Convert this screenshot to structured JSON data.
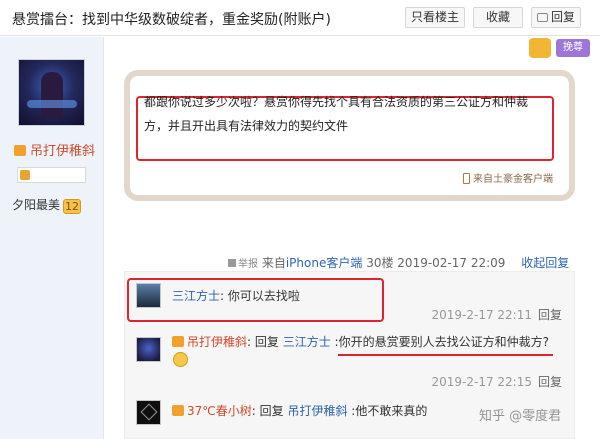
{
  "header": {
    "title": "悬赏擂台：找到中华级数破绽者，重金奖励(附账户)",
    "buttons": {
      "only_op": "只看楼主",
      "favorite": "收藏",
      "reply": "回复"
    }
  },
  "user": {
    "name": "吊打伊稚斜",
    "level_name": "夕阳最美",
    "level": "12"
  },
  "post": {
    "feature_card_label": "挽尊",
    "text": "都跟你说过多少次啦？悬赏你得先找个具有合法资质的第三公证方和仲裁方，并且开出具有法律效力的契约文件",
    "client": "来自土豪金客户端",
    "meta": {
      "report": "举报",
      "source_prefix": "来自",
      "source_client": "iPhone客户端",
      "floor": "30楼",
      "time": "2019-02-17 22:09",
      "collapse": "收起回复"
    }
  },
  "replies": [
    {
      "user": "三江方士",
      "separator": ": ",
      "text": "你可以去找啦",
      "time": "2019-2-17 22:11",
      "reply_label": "回复"
    },
    {
      "user": "吊打伊稚斜",
      "separator": ": ",
      "reply_word": "回复 ",
      "reply_to": "三江方士",
      "text": " :你开的悬赏要别人去找公证方和仲裁方?",
      "time": "2019-2-17 22:15",
      "reply_label": "回复"
    },
    {
      "temp": "37℃",
      "user": "春小树",
      "separator": ": ",
      "reply_word": "回复 ",
      "reply_to": "吊打伊稚斜",
      "text": " :他不敢来真的"
    }
  ],
  "watermark": "知乎 @零度君",
  "colors": {
    "highlight_red": "#e0242e",
    "link_blue": "#2d64b3",
    "username_red": "#d04a2a"
  }
}
